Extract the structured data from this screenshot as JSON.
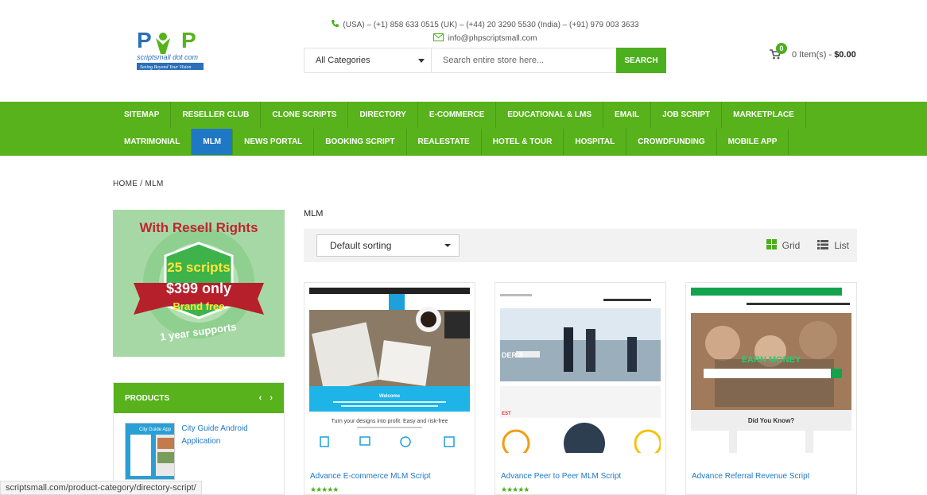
{
  "header": {
    "logo": {
      "text": "scriptsmall dot com",
      "tagline": "Seeing Beyond Your Vision"
    },
    "phone": "(USA) – (+1) 858 633 0515 (UK) – (+44) 20 3290 5530 (India) – (+91) 979 003 3633",
    "email": "info@phpscriptsmall.com",
    "search": {
      "category": "All Categories",
      "placeholder": "Search entire store here...",
      "button": "SEARCH"
    },
    "cart": {
      "count": "0",
      "items": "0 Item(s) -",
      "total": "$0.00"
    }
  },
  "nav": {
    "row1": [
      "SITEMAP",
      "RESELLER CLUB",
      "CLONE SCRIPTS",
      "DIRECTORY",
      "E-COMMERCE",
      "EDUCATIONAL & LMS",
      "EMAIL",
      "JOB SCRIPT",
      "MARKETPLACE"
    ],
    "row2": [
      "MATRIMONIAL",
      "MLM",
      "NEWS PORTAL",
      "BOOKING SCRIPT",
      "REALESTATE",
      "HOTEL & TOUR",
      "HOSPITAL",
      "CROWDFUNDING",
      "MOBILE APP"
    ],
    "active": "MLM"
  },
  "breadcrumb": {
    "home": "HOME",
    "sep": "/",
    "current": "MLM"
  },
  "banner": {
    "line1": "With Resell Rights",
    "line2": "25 scripts",
    "line3": "$399 only",
    "line4": "Brand free",
    "line5": "1 year supports"
  },
  "sidebar_products": {
    "title": "PRODUCTS",
    "prev": "‹",
    "next": "›",
    "item_title": "City Guide Android Application",
    "thumb_text": "City Guide App"
  },
  "category_title": "MLM",
  "toolbar": {
    "sort": "Default sorting",
    "grid": "Grid",
    "list": "List"
  },
  "products": [
    {
      "title": "Advance E-commerce MLM Script",
      "stars": "★★★★★",
      "welcome": "Welcome",
      "caption": "Turn your designs into profit. Easy and risk-free"
    },
    {
      "title": "Advance Peer to Peer MLM Script",
      "stars": "★★★★★",
      "badge": "DER 3",
      "badge2": "EST"
    },
    {
      "title": "Advance Referral Revenue Script",
      "stars": "",
      "hero": "EARN MONEY",
      "question": "Did You Know?"
    }
  ],
  "status_url": "scriptsmall.com/product-category/directory-script/",
  "colors": {
    "green": "#58b21c",
    "blue": "#1f78c4"
  }
}
